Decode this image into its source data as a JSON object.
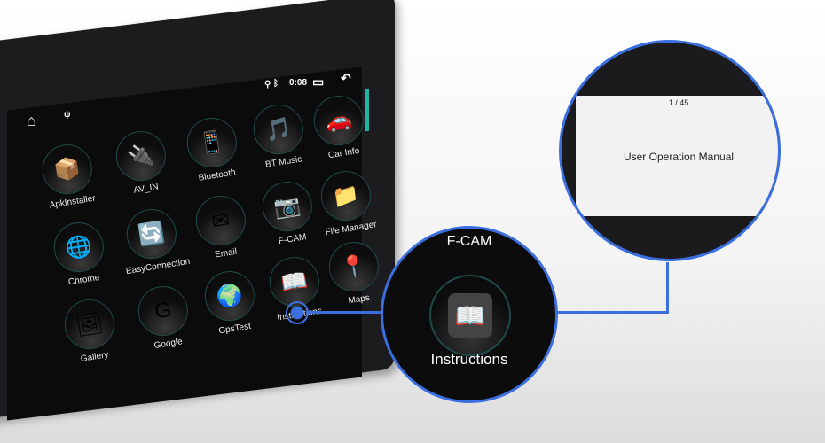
{
  "status": {
    "time": "0:08",
    "icons": [
      "location-icon",
      "bluetooth-icon",
      "recent-apps-icon",
      "back-icon"
    ]
  },
  "nav": {
    "icons": [
      "home-icon",
      "usb-icon"
    ]
  },
  "side_buttons": [
    "power-icon",
    "home-icon",
    "back-icon",
    "volume-up-icon",
    "volume-down-icon"
  ],
  "apps": [
    {
      "label": "ApkInstaller",
      "glyph": "📦"
    },
    {
      "label": "AV_IN",
      "glyph": "🔌"
    },
    {
      "label": "Bluetooth",
      "glyph": "📱"
    },
    {
      "label": "BT Music",
      "glyph": "🎵"
    },
    {
      "label": "Car Info",
      "glyph": "🚗"
    },
    {
      "label": "Chrome",
      "glyph": "🌐"
    },
    {
      "label": "EasyConnection",
      "glyph": "🔄"
    },
    {
      "label": "Email",
      "glyph": "✉"
    },
    {
      "label": "F-CAM",
      "glyph": "📷"
    },
    {
      "label": "File Manager",
      "glyph": "📁"
    },
    {
      "label": "Gallery",
      "glyph": "🖼"
    },
    {
      "label": "Google",
      "glyph": "G"
    },
    {
      "label": "GpsTest",
      "glyph": "🌍"
    },
    {
      "label": "Instructions",
      "glyph": "📖"
    },
    {
      "label": "Maps",
      "glyph": "📍"
    }
  ],
  "zoom": {
    "above_label": "F-CAM",
    "label": "Instructions"
  },
  "manual": {
    "page": "1 / 45",
    "title": "User Operation Manual"
  },
  "accent": "#3b6fe0"
}
